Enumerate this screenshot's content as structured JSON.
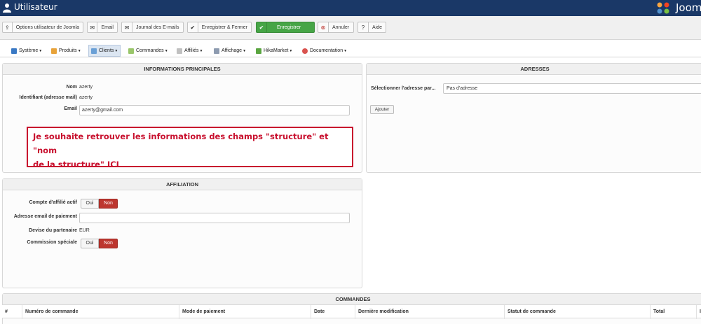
{
  "header": {
    "title": "Utilisateur",
    "logo_text": "Joom"
  },
  "toolbar": {
    "buttons": [
      {
        "label": "Options utilisateur de Joomla",
        "icon": "upload-icon"
      },
      {
        "label": "Email",
        "icon": "envelope-icon"
      },
      {
        "label": "Journal des E-mails",
        "icon": "envelope-icon"
      },
      {
        "label": "Enregistrer & Fermer",
        "icon": "check-icon"
      },
      {
        "label": "Enregistrer",
        "icon": "check-icon"
      },
      {
        "label": "Annuler",
        "icon": "cancel-icon"
      },
      {
        "label": "Aide",
        "icon": "question-icon"
      }
    ]
  },
  "menu": {
    "items": [
      {
        "label": "Système",
        "icon": "wrench-icon"
      },
      {
        "label": "Produits",
        "icon": "box-icon"
      },
      {
        "label": "Clients",
        "icon": "users-icon"
      },
      {
        "label": "Commandes",
        "icon": "cart-icon"
      },
      {
        "label": "Affiliés",
        "icon": "affiliate-icon"
      },
      {
        "label": "Affichage",
        "icon": "display-icon"
      },
      {
        "label": "HikaMarket",
        "icon": "hikamarket-icon"
      },
      {
        "label": "Documentation",
        "icon": "lifebuoy-icon"
      }
    ]
  },
  "main_info": {
    "title": "INFORMATIONS PRINCIPALES",
    "name_label": "Nom",
    "name_value": "azerty",
    "login_label": "Identifiant (adresse mail)",
    "login_value": "azerty",
    "email_label": "Email",
    "email_value": "azerty@gmail.com",
    "note_line1": "Je souhaite retrouver les informations des champs \"structure\" et \"nom",
    "note_line2": "de la structure\" ICI"
  },
  "addresses": {
    "title": "ADRESSES",
    "select_label": "Sélectionner l'adresse par...",
    "select_value": "Pas d'adresse",
    "add_button": "Ajouter"
  },
  "affiliation": {
    "title": "AFFILIATION",
    "account_label": "Compte d'affilié actif",
    "payment_email_label": "Adresse email de paiement",
    "currency_label": "Devise du partenaire",
    "currency_value": "EUR",
    "commission_label": "Commission spéciale",
    "yes": "Oui",
    "no": "Non"
  },
  "orders": {
    "title": "COMMANDES",
    "columns": [
      "#",
      "Numéro de commande",
      "Mode de paiement",
      "Date",
      "Dernière modification",
      "Statut de commande",
      "Total",
      "I"
    ]
  }
}
